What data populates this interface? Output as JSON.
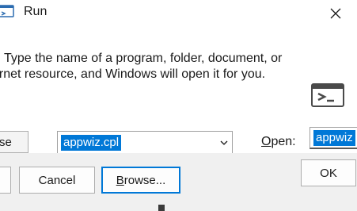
{
  "window": {
    "title": "Run",
    "icon": "run-app-icon",
    "close_icon": "close-icon"
  },
  "body": {
    "description_line1": "Type the name of a program, folder, document, or",
    "description_line2": "ernet resource, and Windows will open it for you.",
    "left_partial_label": "se",
    "open_label_prefix": "",
    "open_label_underlined": "O",
    "open_label_rest": "pen:",
    "open_value": "appwiz.cpl",
    "right_value": "appwiz"
  },
  "buttons": {
    "ok": "OK",
    "cancel": "Cancel",
    "browse_underlined": "B",
    "browse_rest": "rowse..."
  },
  "colors": {
    "selection": "#0078d7",
    "footer_bg": "#f0f0f0",
    "focus_border": "#0078d7"
  }
}
